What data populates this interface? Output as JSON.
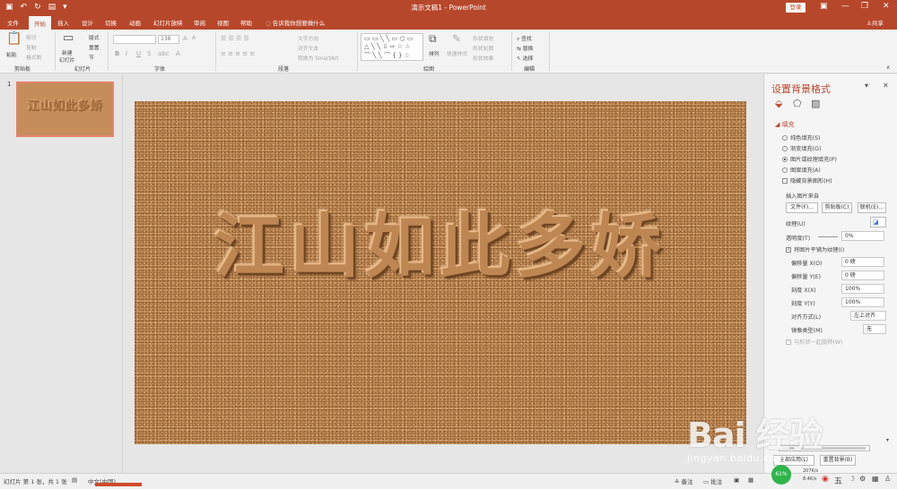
{
  "window": {
    "title": "演示文稿1  -  PowerPoint",
    "login_label": "登录"
  },
  "tabs": [
    {
      "label": "文件"
    },
    {
      "label": "开始"
    },
    {
      "label": "插入"
    },
    {
      "label": "设计"
    },
    {
      "label": "切换"
    },
    {
      "label": "动画"
    },
    {
      "label": "幻灯片放映"
    },
    {
      "label": "审阅"
    },
    {
      "label": "视图"
    },
    {
      "label": "帮助"
    }
  ],
  "tell_me": "告诉我你想要做什么",
  "share_label": "共享",
  "ribbon": {
    "clipboard": {
      "label": "剪贴板",
      "paste": "粘贴",
      "cut": "剪切",
      "copy": "复制",
      "format_painter": "格式刷"
    },
    "slides": {
      "label": "幻灯片",
      "new_slide": "新建",
      "new_slide2": "幻灯片",
      "layout": "版式",
      "reset": "重置",
      "section": "节"
    },
    "font": {
      "label": "字体",
      "size_value": "138"
    },
    "paragraph": {
      "label": "段落",
      "text_direction": "文字方向",
      "align_text": "对齐文本",
      "smartart": "转换为 SmartArt"
    },
    "drawing": {
      "label": "绘图",
      "arrange": "排列",
      "quick_styles": "快速样式",
      "shape_fill": "形状填充",
      "shape_outline": "形状轮廓",
      "shape_effects": "形状效果"
    },
    "editing": {
      "label": "编辑",
      "find": "查找",
      "replace": "替换",
      "select": "选择"
    }
  },
  "thumbnail": {
    "number": "1",
    "text": "江山如此多娇"
  },
  "slide": {
    "text": "江山如此多娇"
  },
  "format_pane": {
    "title": "设置背景格式",
    "section_fill": "填充",
    "fill_options": [
      {
        "label": "纯色填充(S)",
        "checked": false
      },
      {
        "label": "渐变填充(G)",
        "checked": false
      },
      {
        "label": "图片或纹理填充(P)",
        "checked": true
      },
      {
        "label": "图案填充(A)",
        "checked": false
      }
    ],
    "hide_background": "隐藏背景图形(H)",
    "insert_from": "插入图片来自",
    "btn_file": "文件(F)...",
    "btn_clipboard": "剪贴板(C)",
    "btn_online": "联机(E)...",
    "texture": "纹理(U)",
    "transparency": "透明度(T)",
    "transparency_value": "0%",
    "tile": "将图片平铺为纹理(I)",
    "offset_x": "偏移量 X(O)",
    "offset_x_value": "0 磅",
    "offset_y": "偏移量 Y(E)",
    "offset_y_value": "0 磅",
    "scale_x": "刻度 X(X)",
    "scale_x_value": "100%",
    "scale_y": "刻度 Y(Y)",
    "scale_y_value": "100%",
    "alignment": "对齐方式(L)",
    "alignment_value": "左上对齐",
    "mirror": "镜像类型(M)",
    "mirror_value": "无",
    "rotate_with_shape": "与形状一起旋转(W)",
    "apply_all": "全部应用(L)",
    "reset_bg": "重置背景(B)"
  },
  "status": {
    "slide_info": "幻灯片 第 1 张，共 1 张",
    "language": "中文(中国)",
    "notes": "备注",
    "comments": "批注",
    "net_percent": "61%",
    "net_up": "207K/s",
    "net_down": "8.4K/s"
  },
  "watermark": {
    "brand": "Bai  经验",
    "sub": "jingyan.baidu.com"
  }
}
